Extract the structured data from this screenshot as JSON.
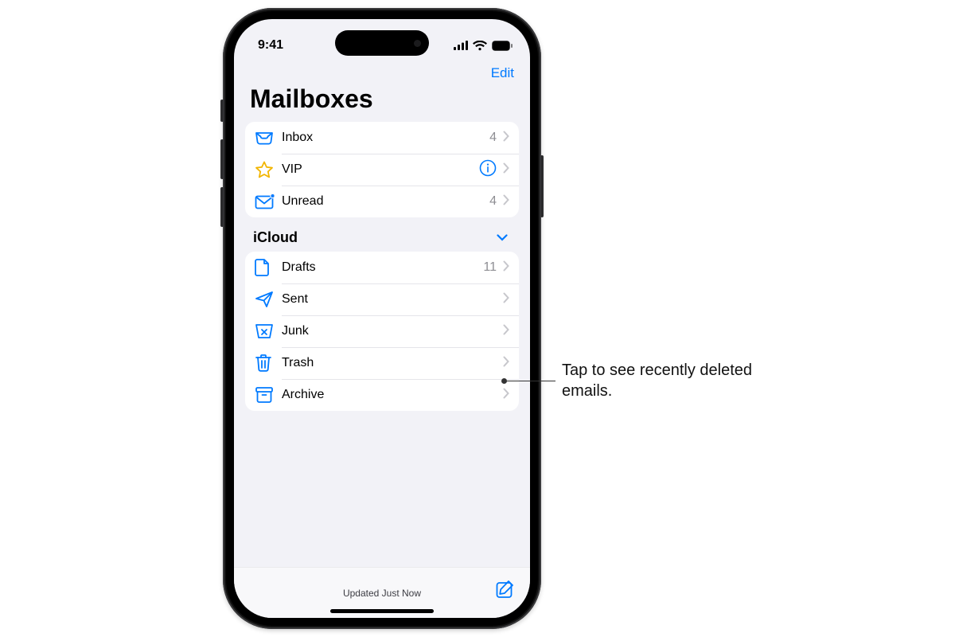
{
  "status": {
    "time": "9:41"
  },
  "nav": {
    "edit": "Edit"
  },
  "title": "Mailboxes",
  "smart": [
    {
      "icon": "inbox",
      "label": "Inbox",
      "count": "4",
      "accessory": "chevron"
    },
    {
      "icon": "star",
      "label": "VIP",
      "count": "",
      "accessory": "info"
    },
    {
      "icon": "unread",
      "label": "Unread",
      "count": "4",
      "accessory": "chevron"
    }
  ],
  "section": {
    "label": "iCloud"
  },
  "icloud": [
    {
      "icon": "doc",
      "label": "Drafts",
      "count": "11"
    },
    {
      "icon": "send",
      "label": "Sent",
      "count": ""
    },
    {
      "icon": "junk",
      "label": "Junk",
      "count": ""
    },
    {
      "icon": "trash",
      "label": "Trash",
      "count": ""
    },
    {
      "icon": "archive",
      "label": "Archive",
      "count": ""
    }
  ],
  "toolbar": {
    "status": "Updated Just Now"
  },
  "callout": {
    "text": "Tap to see recently deleted emails."
  }
}
